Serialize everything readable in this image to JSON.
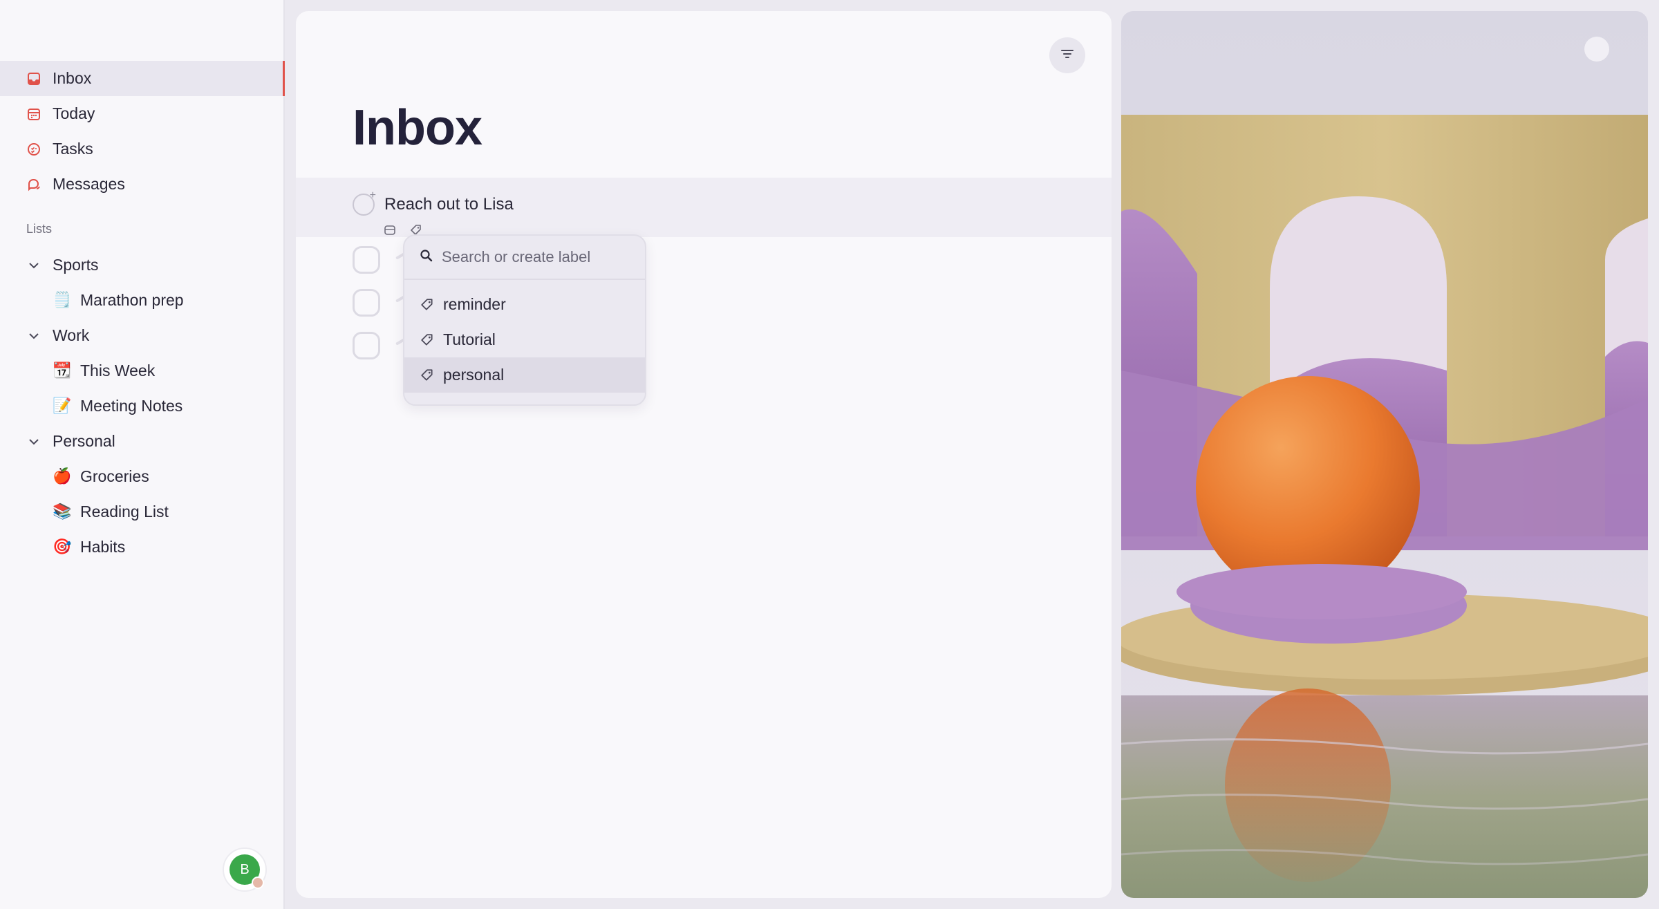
{
  "sidebar": {
    "nav": [
      {
        "label": "Inbox",
        "icon": "inbox-icon"
      },
      {
        "label": "Today",
        "icon": "calendar-icon"
      },
      {
        "label": "Tasks",
        "icon": "tasks-icon"
      },
      {
        "label": "Messages",
        "icon": "messages-icon"
      }
    ],
    "lists_label": "Lists",
    "groups": [
      {
        "label": "Sports",
        "items": [
          {
            "emoji": "🗒️",
            "label": "Marathon prep"
          }
        ]
      },
      {
        "label": "Work",
        "items": [
          {
            "emoji": "📆",
            "label": "This Week"
          },
          {
            "emoji": "📝",
            "label": "Meeting Notes"
          }
        ]
      },
      {
        "label": "Personal",
        "items": [
          {
            "emoji": "🍎",
            "label": "Groceries"
          },
          {
            "emoji": "📚",
            "label": "Reading List"
          },
          {
            "emoji": "🎯",
            "label": "Habits"
          }
        ]
      }
    ],
    "user_initial": "B"
  },
  "main": {
    "title": "Inbox",
    "selected_task": "Reach out to Lisa",
    "label_popup": {
      "placeholder": "Search or create label",
      "options": [
        "reminder",
        "Tutorial",
        "personal"
      ],
      "highlighted": "personal"
    }
  },
  "colors": {
    "accent": "#e0524a",
    "avatar": "#3aa84a"
  }
}
